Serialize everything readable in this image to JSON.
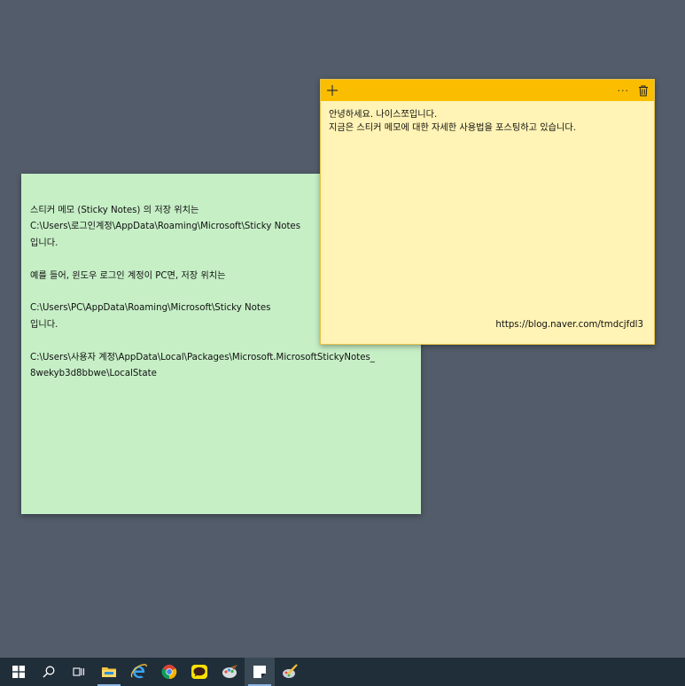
{
  "green_note": {
    "lines": [
      "스티커 메모 (Sticky Notes) 의 저장 위치는",
      "C:\\Users\\로그인계정\\AppData\\Roaming\\Microsoft\\Sticky Notes",
      "입니다.",
      "",
      "예를 들어, 윈도우 로그인 계정이 PC면, 저장 위치는",
      "",
      "C:\\Users\\PC\\AppData\\Roaming\\Microsoft\\Sticky Notes",
      "입니다.",
      "",
      "C:\\Users\\사용자 계정\\AppData\\Local\\Packages\\Microsoft.MicrosoftStickyNotes_",
      "8wekyb3d8bbwe\\LocalState"
    ]
  },
  "yellow_note": {
    "lines": [
      "안녕하세요. 나이스쪼입니다.",
      "지금은 스티커 메모에 대한 자세한 사용법을 포스팅하고 있습니다."
    ],
    "footer": "https://blog.naver.com/tmdcjfdl3",
    "menu_label": "···"
  },
  "colors": {
    "desktop": "#535c6a",
    "green_note": "#c6efc6",
    "yellow_note": "#fff3b5",
    "yellow_header": "#fbbd00",
    "taskbar": "#202e3a"
  },
  "taskbar": {
    "items": [
      {
        "icon": "windows-start-icon"
      },
      {
        "icon": "search-icon"
      },
      {
        "icon": "task-view-icon"
      },
      {
        "icon": "file-explorer-icon"
      },
      {
        "icon": "internet-explorer-icon"
      },
      {
        "icon": "chrome-icon"
      },
      {
        "icon": "kakaotalk-icon"
      },
      {
        "icon": "paint-app-icon"
      },
      {
        "icon": "sticky-notes-icon"
      },
      {
        "icon": "paint-brush-icon"
      }
    ]
  }
}
